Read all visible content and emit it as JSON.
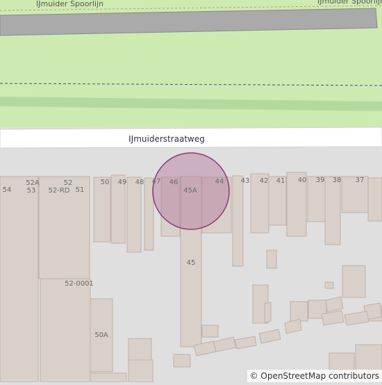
{
  "map": {
    "railway_label_left": "IJmuider Spoorlijn",
    "railway_label_right": "IJmuider Spoorlijn",
    "street_label": "IJmuiderstraatweg",
    "house_numbers": [
      "54",
      "52A",
      "53",
      "52",
      "52-RD",
      "51",
      "50",
      "49",
      "48",
      "47",
      "46",
      "45A",
      "44",
      "43",
      "42",
      "41",
      "40",
      "39",
      "38",
      "37",
      "45",
      "52-0001",
      "50A"
    ],
    "marker_color": "#b4789d",
    "colors": {
      "grass": "#cdebb0",
      "grass_dark": "#b5d99d",
      "road": "#ffffff",
      "building": "#d9d0c9",
      "building_outline": "#bfb1a6",
      "landuse": "#e0dfdf",
      "rail": "#aaaaaa"
    }
  },
  "attribution": {
    "symbol": "©",
    "text": "OpenStreetMap contributors"
  }
}
